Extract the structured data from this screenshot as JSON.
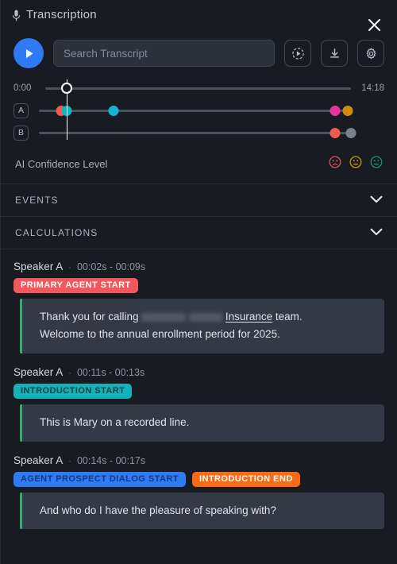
{
  "header": {
    "title": "Transcription",
    "mic_icon": "microphone-icon",
    "close_icon": "close-icon"
  },
  "controls": {
    "play_icon": "play-icon",
    "search_placeholder": "Search Transcript",
    "search_value": "",
    "buttons": [
      {
        "name": "playback-speed-button",
        "icon": "playback-speed-icon"
      },
      {
        "name": "download-button",
        "icon": "download-icon"
      },
      {
        "name": "settings-button",
        "icon": "gear-icon"
      }
    ]
  },
  "timeline": {
    "start_time": "0:00",
    "end_time": "14:18",
    "playhead_percent": 7,
    "tracks": [
      {
        "label": "A",
        "markers": [
          {
            "percent": 7,
            "color": "#f0594f"
          },
          {
            "percent": 9,
            "color": "#0fb3c9"
          },
          {
            "percent": 24,
            "color": "#12b3d4"
          },
          {
            "percent": 95,
            "color": "#e8339b"
          },
          {
            "percent": 99,
            "color": "#d08a0c"
          }
        ]
      },
      {
        "label": "B",
        "markers": [
          {
            "percent": 95,
            "color": "#f0594f"
          },
          {
            "percent": 100,
            "color": "#7a808c"
          }
        ]
      }
    ]
  },
  "confidence": {
    "label": "AI Confidence Level",
    "faces": [
      {
        "name": "confidence-face-low",
        "color": "#e8565c",
        "mouth": "sad"
      },
      {
        "name": "confidence-face-medium",
        "color": "#d6a50c",
        "mouth": "neutral"
      },
      {
        "name": "confidence-face-high",
        "color": "#16a06e",
        "mouth": "flat"
      }
    ]
  },
  "accordion": [
    {
      "name": "events-section",
      "label": "EVENTS",
      "icon": "chevron-down-icon"
    },
    {
      "name": "calculations-section",
      "label": "CALCULATIONS",
      "icon": "chevron-down-icon"
    }
  ],
  "transcript": {
    "entries": [
      {
        "speaker": "Speaker A",
        "separator": "·",
        "times": "00:02s - 00:09s",
        "badges": [
          {
            "label": "PRIMARY AGENT START",
            "bg": "#f1575d",
            "fg": "#ffffff"
          }
        ],
        "text_before": "Thank you for calling ",
        "redacted": [
          "redacted-name-1",
          "redacted-name-2"
        ],
        "underlined": "Insurance",
        "text_after": " team.",
        "text_line2": "Welcome to the annual enrollment period for 2025."
      },
      {
        "speaker": "Speaker A",
        "separator": "·",
        "times": "00:11s - 00:13s",
        "badges": [
          {
            "label": "INTRODUCTION START",
            "bg": "#13b2b8",
            "fg": "#0d4347"
          }
        ],
        "text": "This is Mary on a recorded line."
      },
      {
        "speaker": "Speaker A",
        "separator": "·",
        "times": "00:14s - 00:17s",
        "badges": [
          {
            "label": "AGENT PROSPECT DIALOG START",
            "bg": "#2f7bf6",
            "fg": "#103a76"
          },
          {
            "label": "INTRODUCTION END",
            "bg": "#f96a16",
            "fg": "#ffffff"
          }
        ],
        "text": "And who do I have the pleasure of speaking with?"
      }
    ]
  }
}
